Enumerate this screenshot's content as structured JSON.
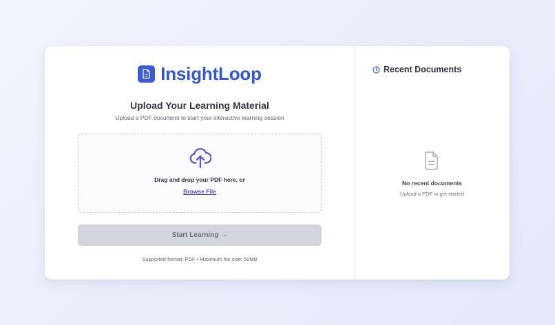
{
  "brand": {
    "name": "InsightLoop",
    "logo_icon": "document-icon",
    "color": "#3357d4"
  },
  "upload": {
    "title": "Upload Your Learning Material",
    "subtitle": "Upload a PDF document to start your interactive learning session",
    "dropzone": {
      "icon": "cloud-upload-icon",
      "text": "Drag and drop your PDF here, or",
      "browse_label": "Browse File"
    },
    "start_button": {
      "label": "Start Learning →",
      "enabled": false
    },
    "footnote": "Supported format: PDF • Maximum file size: 50MB"
  },
  "recent": {
    "title": "Recent Documents",
    "header_icon": "clock-icon",
    "empty_icon": "document-icon",
    "empty_title": "No recent documents",
    "empty_subtitle": "Upload a PDF to get started"
  },
  "colors": {
    "accent": "#3a5bd9",
    "link": "#4e49d6",
    "upload_icon": "#5a57d6",
    "disabled_button": "#d2d5db"
  }
}
